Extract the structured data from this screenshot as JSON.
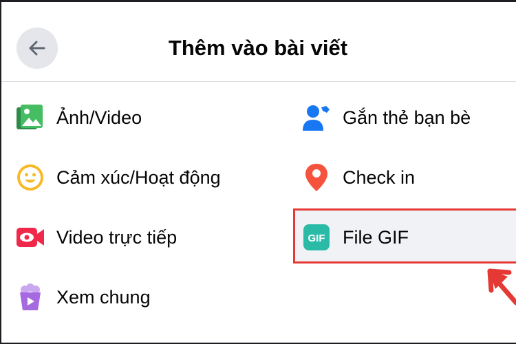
{
  "header": {
    "title": "Thêm vào bài viết",
    "back_icon": "arrow-left-icon"
  },
  "options": {
    "left": [
      {
        "label": "Ảnh/Video",
        "icon": "photo-video-icon",
        "color": "#45bd62"
      },
      {
        "label": "Cảm xúc/Hoạt động",
        "icon": "smiley-icon",
        "color": "#f7b928"
      },
      {
        "label": "Video trực tiếp",
        "icon": "live-video-icon",
        "color": "#f02849"
      },
      {
        "label": "Xem chung",
        "icon": "watch-party-icon",
        "color": "#a66ae0"
      }
    ],
    "right": [
      {
        "label": "Gắn thẻ bạn bè",
        "icon": "tag-friends-icon",
        "color": "#1877f2"
      },
      {
        "label": "Check in",
        "icon": "location-pin-icon",
        "color": "#f5533d"
      },
      {
        "label": "File GIF",
        "icon": "gif-icon",
        "color": "#2abba7"
      }
    ]
  },
  "annotation": {
    "highlight_color": "#e53935"
  }
}
